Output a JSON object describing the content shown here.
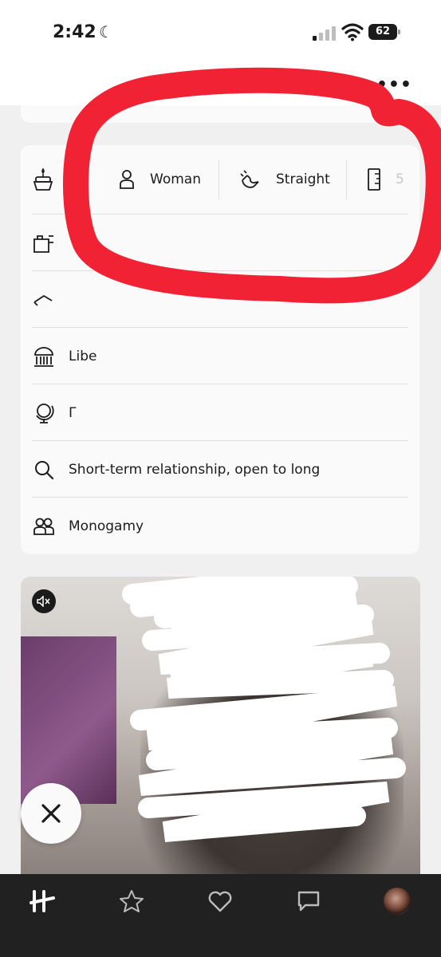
{
  "status_bar": {
    "time": "2:42",
    "battery": "62"
  },
  "header": {
    "more_label": "•••"
  },
  "profile_details": {
    "chips": [
      {
        "icon": "person-icon",
        "label": "Woman"
      },
      {
        "icon": "magnet-icon",
        "label": "Straight"
      },
      {
        "icon": "ruler-icon",
        "label": "5"
      }
    ],
    "rows": [
      {
        "icon": "briefcase-icon",
        "label": ""
      },
      {
        "icon": "graduation-cap-icon",
        "label": ""
      },
      {
        "icon": "institution-icon",
        "label": "Libe"
      },
      {
        "icon": "globe-icon",
        "label": "Γ"
      },
      {
        "icon": "search-icon",
        "label": "Short-term relationship, open to long"
      },
      {
        "icon": "people-icon",
        "label": "Monogamy"
      }
    ]
  },
  "media": {
    "muted": true
  },
  "tab_bar": {
    "items": [
      "home-logo",
      "star",
      "heart",
      "chat",
      "profile-avatar"
    ]
  },
  "colors": {
    "annotation_red": "#f02233",
    "tab_bar_bg": "#222122",
    "card_bg": "#fbfafb",
    "page_bg": "#f1f0f1"
  }
}
